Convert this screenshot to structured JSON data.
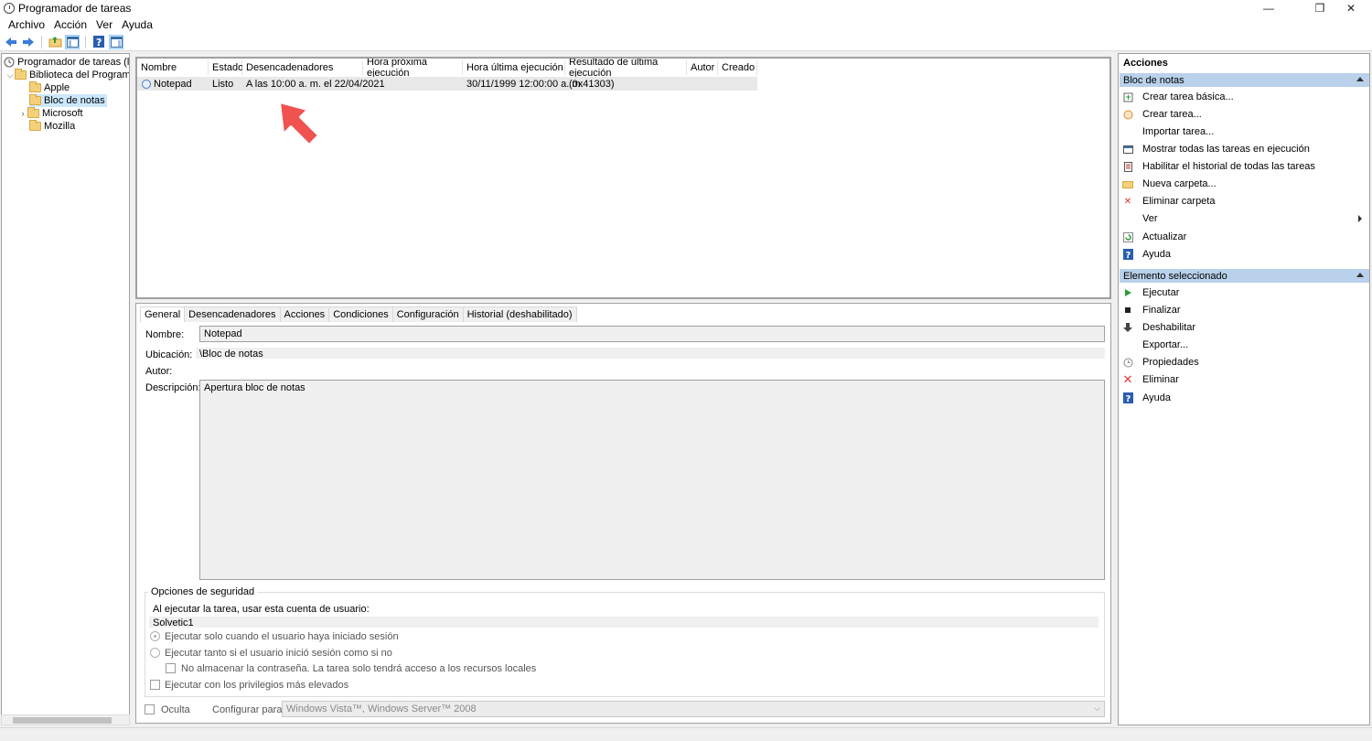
{
  "window": {
    "title": "Programador de tareas",
    "minimize": "—",
    "restore": "❐",
    "close": "✕"
  },
  "menu": [
    "Archivo",
    "Acción",
    "Ver",
    "Ayuda"
  ],
  "tree": {
    "root": "Programador de tareas (local)",
    "library": "Biblioteca del Programador de tareas",
    "folders": [
      "Apple",
      "Bloc de notas",
      "Microsoft",
      "Mozilla"
    ]
  },
  "task_list": {
    "columns": [
      "Nombre",
      "Estado",
      "Desencadenadores",
      "Hora próxima ejecución",
      "Hora última ejecución",
      "Resultado de última ejecución",
      "Autor",
      "Creado"
    ],
    "rows": [
      {
        "name": "Notepad",
        "status": "Listo",
        "trigger": "A las 10:00 a. m. el 22/04/2021",
        "next_run": "",
        "last_run": "30/11/1999 12:00:00 a. m.",
        "last_result": "(0x41303)",
        "author": "",
        "created": ""
      }
    ]
  },
  "tabs": [
    "General",
    "Desencadenadores",
    "Acciones",
    "Condiciones",
    "Configuración",
    "Historial (deshabilitado)"
  ],
  "general": {
    "name_label": "Nombre:",
    "name_value": "Notepad",
    "location_label": "Ubicación:",
    "location_value": "\\Bloc de notas",
    "author_label": "Autor:",
    "author_value": "",
    "description_label": "Descripción:",
    "description_value": "Apertura bloc de notas",
    "security_title": "Opciones de seguridad",
    "account_label": "Al ejecutar la tarea, usar esta cuenta de usuario:",
    "account_value": "Solvetic1",
    "radio_logged_on": "Ejecutar solo cuando el usuario haya iniciado sesión",
    "radio_always": "Ejecutar tanto si el usuario inició sesión como si no",
    "no_store_password": "No almacenar la contraseña. La tarea solo tendrá acceso a los recursos locales",
    "highest_privileges": "Ejecutar con los privilegios más elevados",
    "hidden_label": "Oculta",
    "configure_label": "Configurar para:",
    "configure_value": "Windows Vista™, Windows Server™ 2008"
  },
  "actions_pane": {
    "title": "Acciones",
    "section1_title": "Bloc de notas",
    "section1_items": [
      "Crear tarea básica...",
      "Crear tarea...",
      "Importar tarea...",
      "Mostrar todas las tareas en ejecución",
      "Habilitar el historial de todas las tareas",
      "Nueva carpeta...",
      "Eliminar carpeta",
      "Ver",
      "Actualizar",
      "Ayuda"
    ],
    "section2_title": "Elemento seleccionado",
    "section2_items": [
      "Ejecutar",
      "Finalizar",
      "Deshabilitar",
      "Exportar...",
      "Propiedades",
      "Eliminar",
      "Ayuda"
    ]
  },
  "colors": {
    "selection": "#cce8ff",
    "section_header": "#b9d1ea",
    "annotation_arrow": "#f0524f"
  }
}
